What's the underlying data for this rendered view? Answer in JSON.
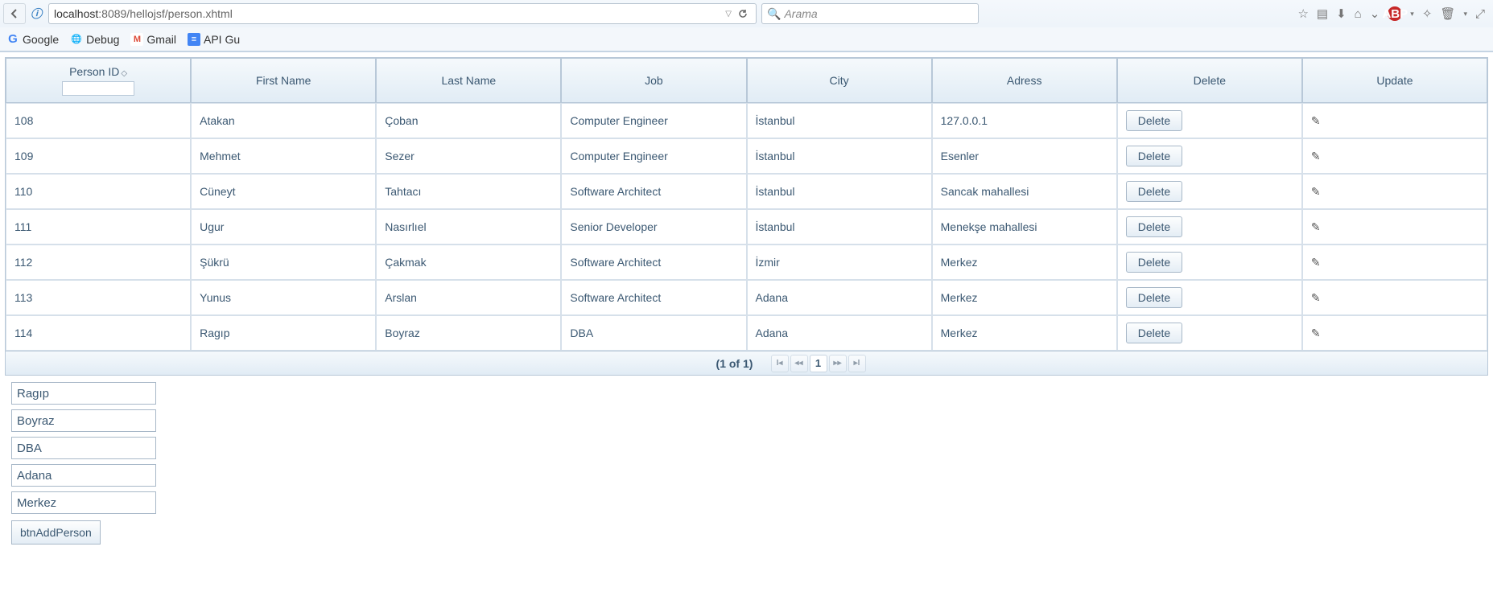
{
  "browser": {
    "url_host": "localhost",
    "url_port_path": ":8089/hellojsf/person.xhtml",
    "search_placeholder": "Arama",
    "bookmarks": [
      {
        "label": "Google"
      },
      {
        "label": "Debug"
      },
      {
        "label": "Gmail"
      },
      {
        "label": "API Gu"
      }
    ]
  },
  "table": {
    "headers": {
      "person_id": "Person ID",
      "first_name": "First Name",
      "last_name": "Last Name",
      "job": "Job",
      "city": "City",
      "address": "Adress",
      "delete": "Delete",
      "update": "Update"
    },
    "delete_btn": "Delete",
    "rows": [
      {
        "id": "108",
        "first": "Atakan",
        "last": "Çoban",
        "job": "Computer Engineer",
        "city": "İstanbul",
        "addr": "127.0.0.1"
      },
      {
        "id": "109",
        "first": "Mehmet",
        "last": "Sezer",
        "job": "Computer Engineer",
        "city": "İstanbul",
        "addr": "Esenler"
      },
      {
        "id": "110",
        "first": "Cüneyt",
        "last": "Tahtacı",
        "job": "Software Architect",
        "city": "İstanbul",
        "addr": "Sancak mahallesi"
      },
      {
        "id": "111",
        "first": "Ugur",
        "last": "Nasırlıel",
        "job": "Senior Developer",
        "city": "İstanbul",
        "addr": "Menekşe mahallesi"
      },
      {
        "id": "112",
        "first": "Şükrü",
        "last": "Çakmak",
        "job": "Software Architect",
        "city": "İzmir",
        "addr": "Merkez"
      },
      {
        "id": "113",
        "first": "Yunus",
        "last": "Arslan",
        "job": "Software Architect",
        "city": "Adana",
        "addr": "Merkez"
      },
      {
        "id": "114",
        "first": "Ragıp",
        "last": "Boyraz",
        "job": "DBA",
        "city": "Adana",
        "addr": "Merkez"
      }
    ],
    "paginator": {
      "info": "(1 of 1)",
      "current": "1"
    }
  },
  "form": {
    "first": "Ragıp",
    "last": "Boyraz",
    "job": "DBA",
    "city": "Adana",
    "addr": "Merkez",
    "add_btn": "btnAddPerson"
  }
}
